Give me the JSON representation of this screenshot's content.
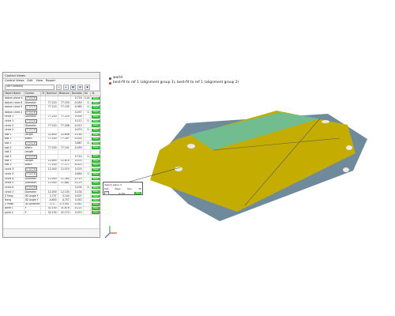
{
  "control_panel": {
    "title": "Control Views",
    "menu": [
      "Control Views",
      "Edit",
      "View",
      "Report"
    ],
    "dropdown_value": "(All Controls)",
    "columns": [
      "Object Name",
      "Control",
      "N",
      "Nominal",
      "Measure",
      "Deviatio",
      "Tol",
      "St"
    ],
    "rows": [
      {
        "name": "datum plane 4",
        "control": "gdt",
        "n": "",
        "nominal": "",
        "measure": "",
        "dev": "0.716",
        "tol": "0.24",
        "st": "Pass"
      },
      {
        "name": "datum circle 6",
        "control": "Diameter",
        "n": "",
        "nominal": "77.220",
        "measure": "77.150",
        "dev": "-0.055",
        "tol": "0.",
        "st": "Pass"
      },
      {
        "name": "datum circle 5",
        "control": "gdt",
        "n": "",
        "nominal": "77.220",
        "measure": "77.135",
        "dev": "-0.085",
        "tol": "0.",
        "st": "Pass"
      },
      {
        "name": "datum circle 2",
        "control": "gdt",
        "n": "",
        "nominal": "",
        "measure": "",
        "dev": "0.037",
        "tol": "0.",
        "st": "Pass"
      },
      {
        "name": "circle 1",
        "control": "Diameter",
        "n": "",
        "nominal": "77.220",
        "measure": "77.220",
        "dev": "0.000",
        "tol": "",
        "st": "Pass"
      },
      {
        "name": "circle 1",
        "control": "gdt",
        "n": "",
        "nominal": "",
        "measure": "",
        "dev": "0.112",
        "tol": "0.",
        "st": "Pass"
      },
      {
        "name": "circle 2",
        "control": "Diameter",
        "n": "",
        "nominal": "77.220",
        "measure": "77.208",
        "dev": "-0.012",
        "tol": "",
        "st": "Pass"
      },
      {
        "name": "circle 2",
        "control": "gdt",
        "n": "",
        "nominal": "",
        "measure": "",
        "dev": "0.070",
        "tol": "0.",
        "st": "Pass"
      },
      {
        "name": "slot 1",
        "control": "Length",
        "n": "",
        "nominal": "22.800",
        "measure": "22.656",
        "dev": "-0.144",
        "tol": "",
        "st": "Pass"
      },
      {
        "name": "slot 1",
        "control": "Width",
        "n": "",
        "nominal": "77.200",
        "measure": "77.167",
        "dev": "-0.033",
        "tol": "",
        "st": "Pass"
      },
      {
        "name": "slot 1",
        "control": "gdt",
        "n": "",
        "nominal": "",
        "measure": "",
        "dev": "0.887",
        "tol": "0.",
        "st": "Pass"
      },
      {
        "name": "slot 2",
        "control": "Width",
        "n": "",
        "nominal": "77.200",
        "measure": "77.141",
        "dev": "-0.059",
        "tol": "",
        "st": "Pass"
      },
      {
        "name": "slot 2",
        "control": "Length",
        "n": "",
        "nominal": "",
        "measure": "",
        "dev": "",
        "tol": "",
        "st": ""
      },
      {
        "name": "slot 2",
        "control": "gdt",
        "n": "",
        "nominal": "",
        "measure": "",
        "dev": "0.714",
        "tol": "0.",
        "st": "Pass"
      },
      {
        "name": "slot 3",
        "control": "Length",
        "n": "",
        "nominal": "22.800",
        "measure": "22.874",
        "dev": "0.074",
        "tol": "",
        "st": "Pass"
      },
      {
        "name": "slot 3",
        "control": "Width",
        "n": "",
        "nominal": "77.200",
        "measure": "77.177",
        "dev": "-0.023",
        "tol": "",
        "st": "Pass"
      },
      {
        "name": "circle 3",
        "control": "gdt",
        "n": "",
        "nominal": "12.000",
        "measure": "12.074",
        "dev": "0.074",
        "tol": "",
        "st": "Pass"
      },
      {
        "name": "circle 3",
        "control": "gdt",
        "n": "",
        "nominal": "",
        "measure": "",
        "dev": "0.644",
        "tol": "0.",
        "st": "Pass"
      },
      {
        "name": "circle 4",
        "control": "Diameter",
        "n": "",
        "nominal": "12.000",
        "measure": "11.285",
        "dev": "-0.715",
        "tol": "",
        "st": "Pass"
      },
      {
        "name": "circle 5",
        "control": "Diameter",
        "n": "",
        "nominal": "12.000",
        "measure": "11.881",
        "dev": "-0.119",
        "tol": "",
        "st": "Pass"
      },
      {
        "name": "circle 6",
        "control": "gdt",
        "n": "",
        "nominal": "",
        "measure": "",
        "dev": "0.204",
        "tol": "0.",
        "st": "Pass"
      },
      {
        "name": "circle 2",
        "control": "Diameter",
        "n": "",
        "nominal": "12.000",
        "measure": "12.134",
        "dev": "0.134",
        "tol": "",
        "st": "Pass"
      },
      {
        "name": "Z Fang",
        "control": "3D Angle Y",
        "n": "",
        "nominal": "2.737",
        "measure": "3.144",
        "dev": "0.407",
        "tol": "",
        "st": "Pass"
      },
      {
        "name": "Hang",
        "control": "3D Angle Y",
        "n": "",
        "nominal": "-4.800",
        "measure": "-4.757",
        "dev": "0.043",
        "tol": "",
        "st": "Pass"
      },
      {
        "name": "Z Mitte",
        "control": "3D Distance",
        "n": "",
        "nominal": "173...",
        "measure": "173.951",
        "dev": "-0.041",
        "tol": "",
        "st": "Pass"
      },
      {
        "name": "point 1",
        "control": "Y",
        "n": "",
        "nominal": "32.100",
        "measure": "31.878",
        "dev": "-0.222",
        "tol": "",
        "st": "Pass"
      },
      {
        "name": "point 2",
        "control": "Y",
        "n": "",
        "nominal": "32.100",
        "measure": "32.170",
        "dev": "0.070",
        "tol": "",
        "st": "Pass"
      }
    ]
  },
  "scene_tree": {
    "root": "world",
    "child": "best-fit to ref 1 (alignment group 1), best-fit to ref 1 (alignment group 2)"
  },
  "callout": {
    "title": "datum plane 4",
    "columns": [
      "Test",
      "Meas.",
      "Dev.",
      "Tol"
    ],
    "measure": "0.716",
    "status": "Pass"
  },
  "colors": {
    "part_yellow": "#c8b400",
    "part_cyan": "#48c2cc",
    "pass_green": "#2db82d"
  }
}
